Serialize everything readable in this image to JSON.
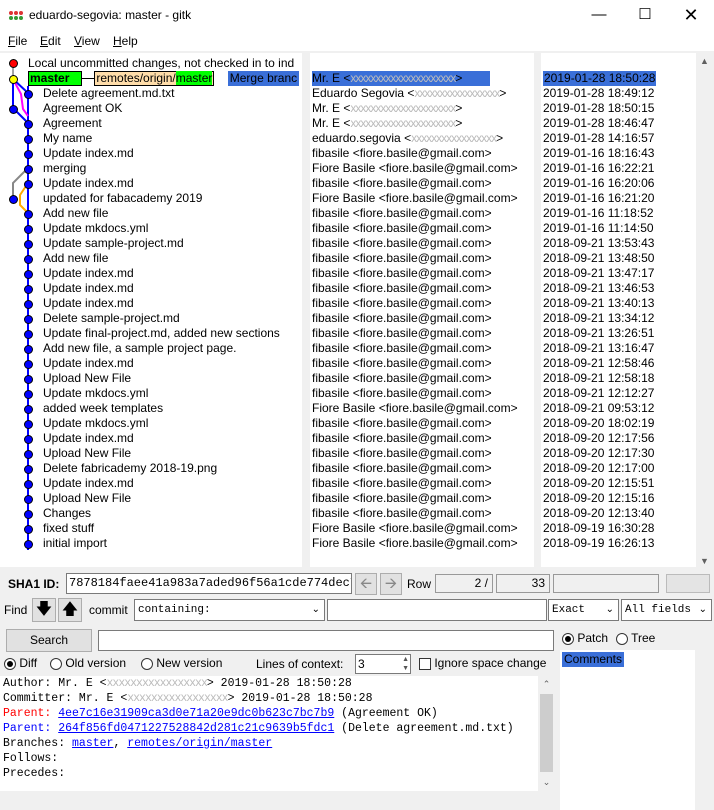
{
  "window": {
    "title": "eduardo-segovia: master - gitk"
  },
  "menu": [
    "File",
    "Edit",
    "View",
    "Help"
  ],
  "menu_underline": [
    "F",
    "E",
    "V",
    "H"
  ],
  "graph": {
    "first_row_text": "Local uncommitted changes, not checked in to ind",
    "ref_master": "master",
    "ref_remote_prefix": "remotes/origin/",
    "ref_remote_branch": "master",
    "head_text": "Merge branc",
    "subjects": [
      "Delete agreement.md.txt",
      "Agreement OK",
      "Agreement",
      "My name",
      "Update index.md",
      "merging",
      "Update index.md",
      "updated for fabacademy 2019",
      "Add new file",
      "Update mkdocs.yml",
      "Update sample-project.md",
      "Add new file",
      "Update index.md",
      "Update index.md",
      "Update index.md",
      "Delete sample-project.md",
      "Update final-project.md, added new sections",
      "Add new file, a sample project page.",
      "Update index.md",
      "Upload New File",
      "Update mkdocs.yml",
      "added week templates",
      "Update mkdocs.yml",
      "Update index.md",
      "Upload New File",
      "Delete fabricademy 2018-19.png",
      "Update index.md",
      "Upload New File",
      "Changes",
      "fixed stuff",
      "initial import"
    ]
  },
  "authors": [
    {
      "name": "Mr. E <",
      "blur": "xxxxxxxxxxxxxxxxxxxxx",
      "end": ">"
    },
    {
      "name": "Eduardo Segovia <",
      "blur": "xxxxxxxxxxxxxxxxx",
      "end": ">"
    },
    {
      "name": "Mr. E <",
      "blur": "xxxxxxxxxxxxxxxxxxxxx",
      "end": ">"
    },
    {
      "name": "Mr. E <",
      "blur": "xxxxxxxxxxxxxxxxxxxxx",
      "end": ">"
    },
    {
      "name": "eduardo.segovia <",
      "blur": "xxxxxxxxxxxxxxxxx",
      "end": ">"
    },
    {
      "name": "fibasile <fiore.basile@gmail.com>",
      "blur": "",
      "end": ""
    },
    {
      "name": "Fiore Basile <fiore.basile@gmail.com>",
      "blur": "",
      "end": ""
    },
    {
      "name": "fibasile <fiore.basile@gmail.com>",
      "blur": "",
      "end": ""
    },
    {
      "name": "Fiore Basile <fiore.basile@gmail.com>",
      "blur": "",
      "end": ""
    },
    {
      "name": "fibasile <fiore.basile@gmail.com>",
      "blur": "",
      "end": ""
    },
    {
      "name": "fibasile <fiore.basile@gmail.com>",
      "blur": "",
      "end": ""
    },
    {
      "name": "fibasile <fiore.basile@gmail.com>",
      "blur": "",
      "end": ""
    },
    {
      "name": "fibasile <fiore.basile@gmail.com>",
      "blur": "",
      "end": ""
    },
    {
      "name": "fibasile <fiore.basile@gmail.com>",
      "blur": "",
      "end": ""
    },
    {
      "name": "fibasile <fiore.basile@gmail.com>",
      "blur": "",
      "end": ""
    },
    {
      "name": "fibasile <fiore.basile@gmail.com>",
      "blur": "",
      "end": ""
    },
    {
      "name": "fibasile <fiore.basile@gmail.com>",
      "blur": "",
      "end": ""
    },
    {
      "name": "fibasile <fiore.basile@gmail.com>",
      "blur": "",
      "end": ""
    },
    {
      "name": "fibasile <fiore.basile@gmail.com>",
      "blur": "",
      "end": ""
    },
    {
      "name": "fibasile <fiore.basile@gmail.com>",
      "blur": "",
      "end": ""
    },
    {
      "name": "fibasile <fiore.basile@gmail.com>",
      "blur": "",
      "end": ""
    },
    {
      "name": "fibasile <fiore.basile@gmail.com>",
      "blur": "",
      "end": ""
    },
    {
      "name": "Fiore Basile <fiore.basile@gmail.com>",
      "blur": "",
      "end": ""
    },
    {
      "name": "fibasile <fiore.basile@gmail.com>",
      "blur": "",
      "end": ""
    },
    {
      "name": "fibasile <fiore.basile@gmail.com>",
      "blur": "",
      "end": ""
    },
    {
      "name": "fibasile <fiore.basile@gmail.com>",
      "blur": "",
      "end": ""
    },
    {
      "name": "fibasile <fiore.basile@gmail.com>",
      "blur": "",
      "end": ""
    },
    {
      "name": "fibasile <fiore.basile@gmail.com>",
      "blur": "",
      "end": ""
    },
    {
      "name": "fibasile <fiore.basile@gmail.com>",
      "blur": "",
      "end": ""
    },
    {
      "name": "fibasile <fiore.basile@gmail.com>",
      "blur": "",
      "end": ""
    },
    {
      "name": "Fiore Basile <fiore.basile@gmail.com>",
      "blur": "",
      "end": ""
    },
    {
      "name": "Fiore Basile <fiore.basile@gmail.com>",
      "blur": "",
      "end": ""
    }
  ],
  "dates": [
    "2019-01-28 18:50:28",
    "2019-01-28 18:49:12",
    "2019-01-28 18:50:15",
    "2019-01-28 18:46:47",
    "2019-01-28 14:16:57",
    "2019-01-16 18:16:43",
    "2019-01-16 16:22:21",
    "2019-01-16 16:20:06",
    "2019-01-16 16:21:20",
    "2019-01-16 11:18:52",
    "2019-01-16 11:14:50",
    "2018-09-21 13:53:43",
    "2018-09-21 13:48:50",
    "2018-09-21 13:47:17",
    "2018-09-21 13:46:53",
    "2018-09-21 13:40:13",
    "2018-09-21 13:34:12",
    "2018-09-21 13:26:51",
    "2018-09-21 13:16:47",
    "2018-09-21 12:58:46",
    "2018-09-21 12:58:18",
    "2018-09-21 12:12:27",
    "2018-09-21 09:53:12",
    "2018-09-20 18:02:19",
    "2018-09-20 12:17:56",
    "2018-09-20 12:17:30",
    "2018-09-20 12:17:00",
    "2018-09-20 12:15:51",
    "2018-09-20 12:15:16",
    "2018-09-20 12:13:40",
    "2018-09-19 16:30:28",
    "2018-09-19 16:26:13"
  ],
  "sha": {
    "label": "SHA1 ID:",
    "value": "7878184faee41a983a7aded96f56a1cde774dec7",
    "row_label": "Row",
    "row_current": "2",
    "row_sep": "/",
    "row_total": "33"
  },
  "find": {
    "label": "Find",
    "commit_label": "commit",
    "type_value": "containing:",
    "match_value": "Exact",
    "fields_value": "All fields"
  },
  "search": {
    "button": "Search"
  },
  "diffopts": {
    "diff": "Diff",
    "old": "Old version",
    "new": "New version",
    "context_label": "Lines of context:",
    "context_value": "3",
    "ignore": "Ignore space change"
  },
  "filetabs": {
    "patch": "Patch",
    "tree": "Tree",
    "comments": "Comments"
  },
  "details": {
    "author_label": "Author: Mr. E <",
    "author_blur": "xxxxxxxxxxxxxxxxx",
    "author_end": ">  2019-01-28 18:50:28",
    "committer_label": "Committer: Mr. E <",
    "committer_blur": "xxxxxxxxxxxxxxxxx",
    "committer_end": ">  2019-01-28 18:50:28",
    "parent1_label": "Parent: ",
    "parent1_hash": "4ee7c16e31909ca3d0e71a20e9dc0b623c7bc7b9",
    "parent1_msg": " (Agreement OK)",
    "parent2_label": "Parent: ",
    "parent2_hash": "264f856fd0471227528842d281c21c9639b5fdc1",
    "parent2_msg": " (Delete agreement.md.txt)",
    "branches_label": "Branches: ",
    "branch1": "master",
    "branch_sep": ", ",
    "branch2": "remotes/origin/master",
    "follows": "Follows:",
    "precedes": "Precedes:"
  },
  "colors": {
    "ref_green": "#00ff00",
    "remote_orange": "#ffddaa",
    "head_blue": "#3a6fd8",
    "dot_blue": "#0000ff"
  }
}
